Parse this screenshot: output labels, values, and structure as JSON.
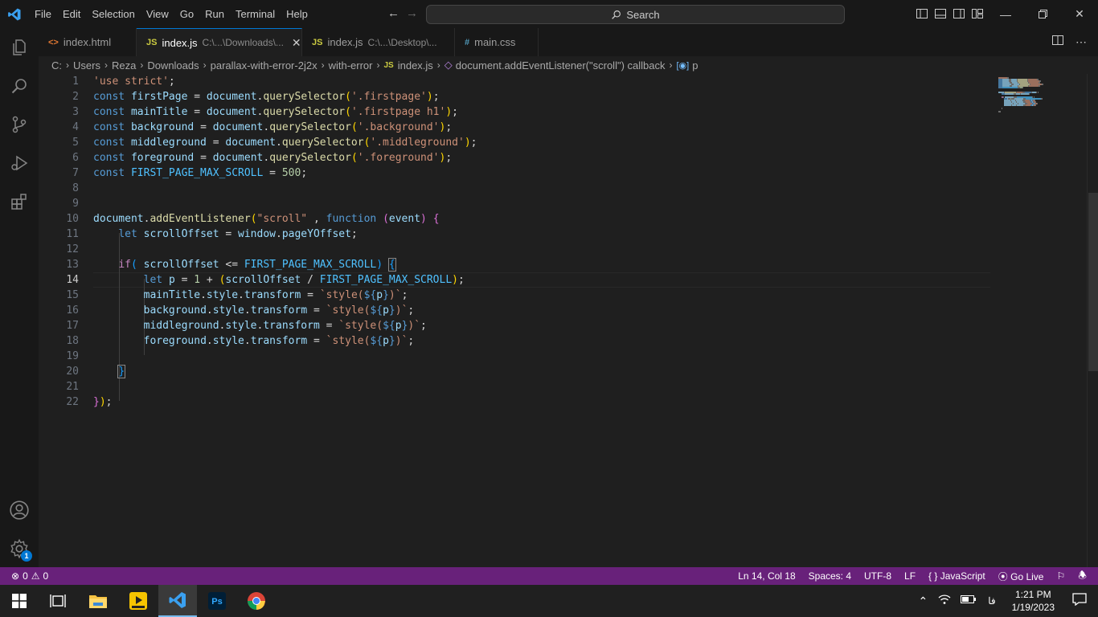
{
  "menu": [
    "File",
    "Edit",
    "Selection",
    "View",
    "Go",
    "Run",
    "Terminal",
    "Help"
  ],
  "search": {
    "label": "Search"
  },
  "tabs": [
    {
      "icon": "<>",
      "name": "index.html",
      "desc": ""
    },
    {
      "icon": "JS",
      "name": "index.js",
      "desc": "C:\\...\\Downloads\\..."
    },
    {
      "icon": "JS",
      "name": "index.js",
      "desc": "C:\\...\\Desktop\\..."
    },
    {
      "icon": "#",
      "name": "main.css",
      "desc": ""
    }
  ],
  "breadcrumb": [
    "C:",
    "Users",
    "Reza",
    "Downloads",
    "parallax-with-error-2j2x",
    "with-error",
    "index.js",
    "document.addEventListener(\"scroll\") callback",
    "p"
  ],
  "editor": {
    "line_numbers": [
      "1",
      "2",
      "3",
      "4",
      "5",
      "6",
      "7",
      "8",
      "9",
      "10",
      "11",
      "12",
      "13",
      "14",
      "15",
      "16",
      "17",
      "18",
      "19",
      "20",
      "21",
      "22"
    ],
    "current_line": "14"
  },
  "status": {
    "errors": "0",
    "warnings": "0",
    "position": "Ln 14, Col 18",
    "spaces": "Spaces: 4",
    "encoding": "UTF-8",
    "eol": "LF",
    "language": "JavaScript",
    "golive": "Go Live"
  },
  "taskbar": {
    "time": "1:21 PM",
    "date": "1/19/2023",
    "lang": "فا",
    "apps": [
      "start-icon",
      "task-view-icon",
      "file-explorer-icon",
      "potplayer-icon",
      "vscode-icon",
      "photoshop-icon",
      "chrome-icon"
    ]
  },
  "colors": {
    "statusbar": "#68217a",
    "accent": "#0078d4"
  }
}
